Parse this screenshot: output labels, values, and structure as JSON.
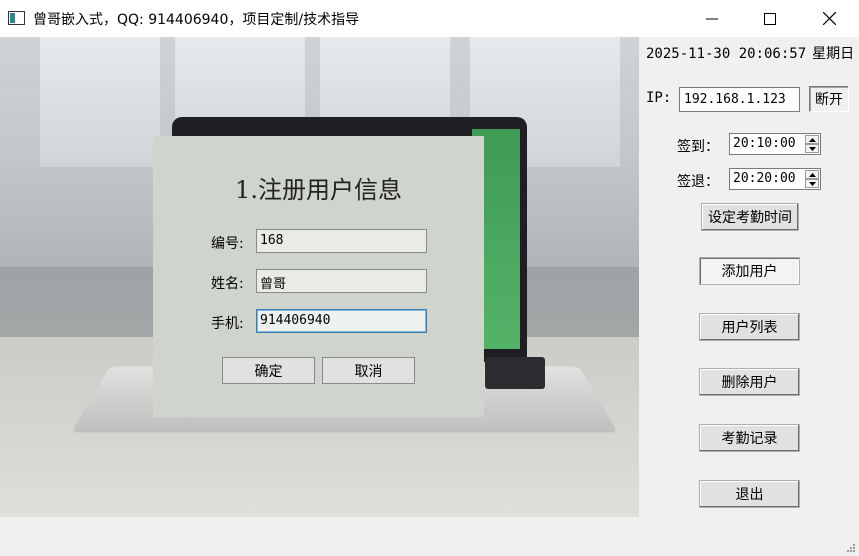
{
  "window": {
    "title": "曾哥嵌入式，QQ: 914406940，项目定制/技术指导",
    "icon": "app-window-icon",
    "controls": [
      "minimize-icon",
      "maximize-icon",
      "close-icon"
    ]
  },
  "dialog": {
    "title": "1.注册用户信息",
    "fields": [
      {
        "label": "编号:",
        "value": "168"
      },
      {
        "label": "姓名:",
        "value": "曾哥"
      },
      {
        "label": "手机:",
        "value": "914406940"
      }
    ],
    "confirm_label": "确定",
    "cancel_label": "取消"
  },
  "side": {
    "datetime": "2025-11-30 20:06:57",
    "weekday": "星期日",
    "ip_label": "IP:",
    "ip_value": "192.168.1.123",
    "disconnect_label": "断开",
    "checkin_label": "签到：",
    "checkin_time": "20:10:00",
    "checkout_label": "签退：",
    "checkout_time": "20:20:00",
    "set_time_label": "设定考勤时间",
    "add_user_label": "添加用户",
    "user_list_label": "用户列表",
    "delete_user_label": "删除用户",
    "records_label": "考勤记录",
    "exit_label": "退出"
  },
  "colors": {
    "dialog_bg": "#cfd4cc",
    "active_input_border": "#3c7fb1",
    "window_bg": "#f0f0f0"
  }
}
